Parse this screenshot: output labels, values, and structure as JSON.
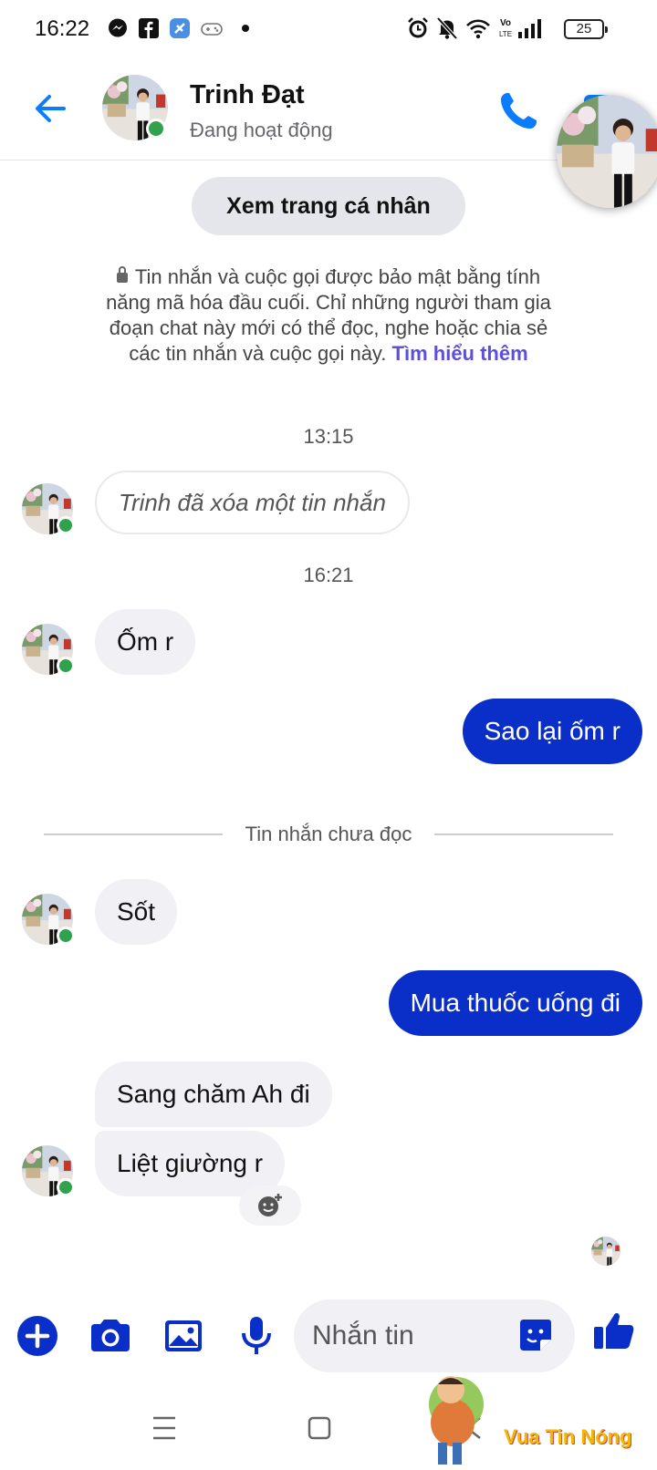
{
  "status_bar": {
    "time": "16:22",
    "battery": "25",
    "notification_icons": [
      "messenger-icon",
      "facebook-icon",
      "app-icon",
      "game-icon",
      "dot-icon"
    ],
    "system_icons": [
      "alarm-icon",
      "mute-icon",
      "wifi-icon",
      "volte-icon",
      "signal-icon",
      "battery-icon"
    ]
  },
  "header": {
    "back_icon": "back-arrow-icon",
    "contact_name": "Trinh Đạt",
    "contact_status": "Đang hoạt động",
    "call_icon": "phone-icon",
    "online": true
  },
  "profile_button": "Xem trang cá nhân",
  "e2e_notice": {
    "text": "Tin nhắn và cuộc gọi được bảo mật bằng tính năng mã hóa đầu cuối. Chỉ những người tham gia đoạn chat này mới có thể đọc, nghe hoặc chia sẻ các tin nhắn và cuộc gọi này.",
    "link": "Tìm hiểu thêm"
  },
  "messages": {
    "time_1": "13:15",
    "deleted": "Trinh đã xóa một tin nhắn",
    "time_2": "16:21",
    "in_1": "Ốm r",
    "out_1": "Sao lại ốm r",
    "unread_divider": "Tin nhắn chưa đọc",
    "in_2": "Sốt",
    "out_2": "Mua thuốc uống đi",
    "in_3": "Sang chăm Ah đi",
    "in_4": "Liệt giường r"
  },
  "composer": {
    "placeholder": "Nhắn tin",
    "value": "",
    "icons": [
      "plus-icon",
      "camera-icon",
      "image-icon",
      "microphone-icon",
      "sticker-icon",
      "thumbs-up-icon"
    ]
  },
  "nav_bar": {
    "icons": [
      "menu-icon",
      "home-icon",
      "back-icon"
    ]
  },
  "watermark": {
    "text": "Vua Tin Nóng"
  },
  "colors": {
    "accent": "#0a7cff",
    "outgoing_bubble": "#0a2fc9",
    "incoming_bubble": "#f0f0f5",
    "online": "#31a24c",
    "link": "#5b4fdb"
  }
}
